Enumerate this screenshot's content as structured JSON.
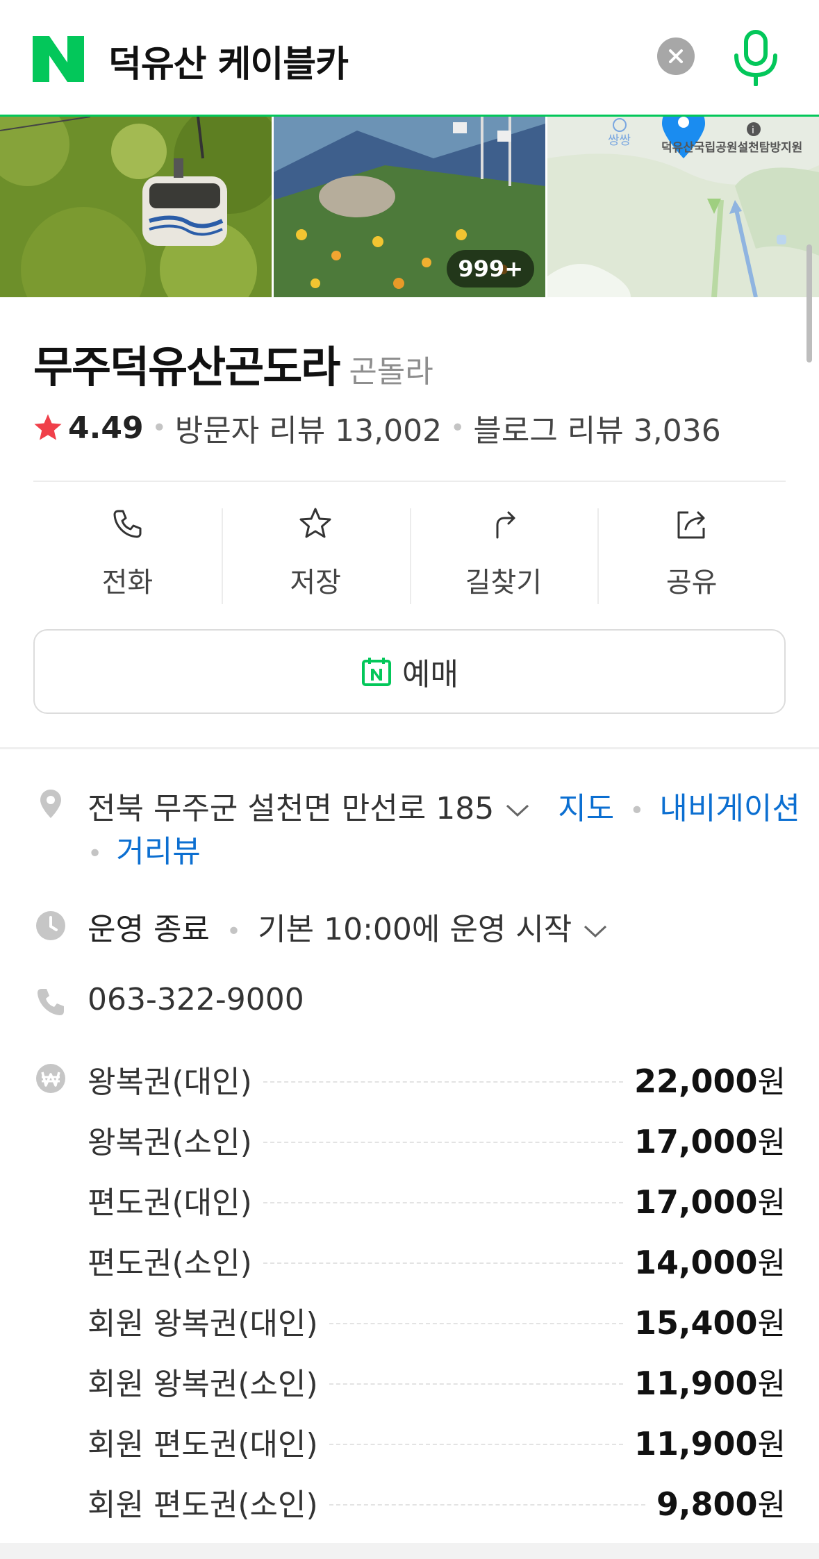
{
  "search": {
    "query": "덕유산 케이블카"
  },
  "photos": {
    "more_count": "999+"
  },
  "map_thumb": {
    "poi_label": "쌍쌍",
    "place_label": "덕유산국립공원설천탐방지원"
  },
  "place": {
    "name": "무주덕유산곤도라",
    "category": "곤돌라",
    "rating": "4.49",
    "visitor_reviews": "방문자 리뷰 13,002",
    "blog_reviews": "블로그 리뷰 3,036"
  },
  "actions": [
    {
      "label": "전화",
      "icon": "phone-icon"
    },
    {
      "label": "저장",
      "icon": "star-outline-icon"
    },
    {
      "label": "길찾기",
      "icon": "directions-icon"
    },
    {
      "label": "공유",
      "icon": "share-icon"
    }
  ],
  "reserve": {
    "label": "예매"
  },
  "info": {
    "address": "전북 무주군 설천면 만선로 185",
    "map_link": "지도",
    "navigation_link": "내비게이션",
    "streetview_link": "거리뷰",
    "status": "운영 종료",
    "hours": "기본 10:00에 운영 시작",
    "phone": "063-322-9000"
  },
  "prices": [
    {
      "name": "왕복권(대인)",
      "value": "22,000",
      "unit": "원"
    },
    {
      "name": "왕복권(소인)",
      "value": "17,000",
      "unit": "원"
    },
    {
      "name": "편도권(대인)",
      "value": "17,000",
      "unit": "원"
    },
    {
      "name": "편도권(소인)",
      "value": "14,000",
      "unit": "원"
    },
    {
      "name": "회원 왕복권(대인)",
      "value": "15,400",
      "unit": "원"
    },
    {
      "name": "회원 왕복권(소인)",
      "value": "11,900",
      "unit": "원"
    },
    {
      "name": "회원 편도권(대인)",
      "value": "11,900",
      "unit": "원"
    },
    {
      "name": "회원 편도권(소인)",
      "value": "9,800",
      "unit": "원"
    }
  ],
  "colors": {
    "brand_green": "#03c75a",
    "link_blue": "#0c6fd1",
    "star_red": "#f0404a"
  }
}
